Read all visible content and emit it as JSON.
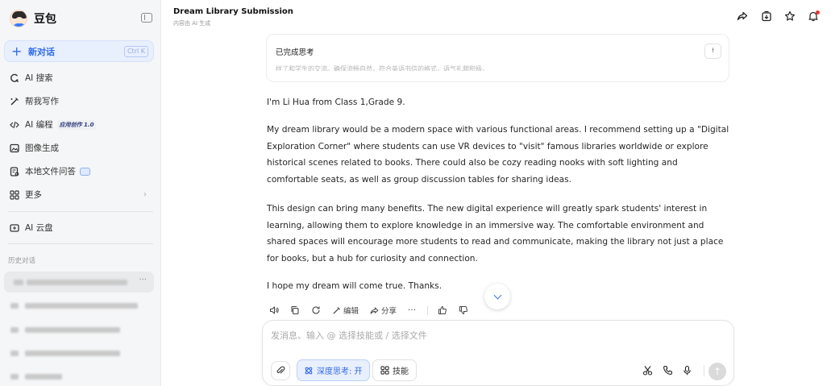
{
  "sidebar": {
    "brand": "豆包",
    "new_chat": {
      "label": "新对话",
      "shortcut": "Ctrl K"
    },
    "nav": [
      {
        "icon": "search-icon",
        "label": "AI 搜索"
      },
      {
        "icon": "pen-icon",
        "label": "帮我写作"
      },
      {
        "icon": "code-icon",
        "label": "AI 编程",
        "badge": "应用创作 1.0"
      },
      {
        "icon": "image-icon",
        "label": "图像生成"
      },
      {
        "icon": "file-qa-icon",
        "label": "本地文件问答"
      },
      {
        "icon": "grid-icon",
        "label": "更多"
      }
    ],
    "cloud": "AI 云盘",
    "history_label": "历史对话"
  },
  "header": {
    "title": "Dream Library Submission",
    "subtitle": "内容由 AI 生成"
  },
  "thinking": {
    "title": "已完成思考",
    "preview": "样了和学生的交流。确保流畅自然，符合英语书信的格式，语气礼貌积极。"
  },
  "message": {
    "p1": "I'm Li Hua from Class 1,Grade 9.",
    "p2": "My dream library would be a modern space with various functional areas. I recommend setting up a \"Digital Exploration Corner\" where students can use VR devices to \"visit\" famous libraries worldwide or explore historical scenes related to books. There could also be cozy reading nooks with soft lighting and comfortable seats, as well as group discussion tables for sharing ideas.",
    "p3": "This design can bring many benefits. The new digital experience will greatly spark students' interest in learning, allowing them to explore knowledge in an immersive way. The comfortable environment and shared spaces will encourage more students to read and communicate, making the library not just a place for books, but a hub for curiosity and connection.",
    "p4": "I hope my dream will come true. Thanks."
  },
  "actions": {
    "edit": "编辑",
    "share": "分享"
  },
  "composer": {
    "placeholder": "发消息、输入 @ 选择技能或 / 选择文件",
    "deep_think": "深度思考: 开",
    "skills": "技能"
  }
}
